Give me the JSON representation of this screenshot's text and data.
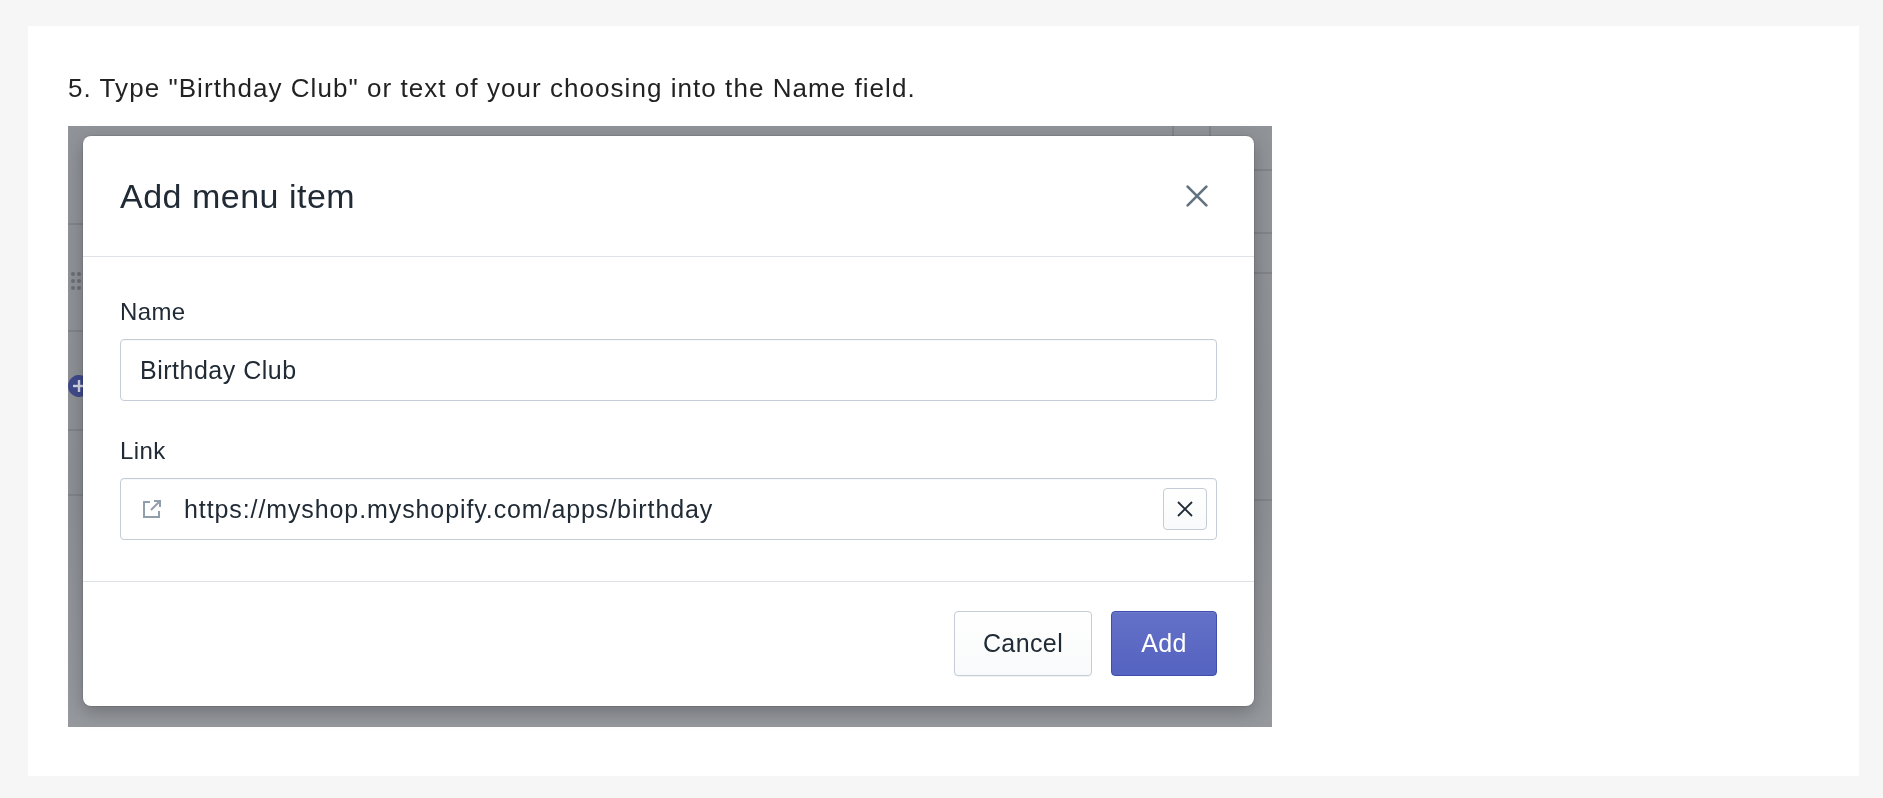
{
  "instruction": "5. Type \"Birthday Club\" or text of your choosing into the Name field.",
  "screenshot": {
    "dialog": {
      "title": "Add menu item",
      "fields": [
        {
          "kind": "text",
          "label": "Name",
          "value": "Birthday Club"
        },
        {
          "kind": "link",
          "label": "Link",
          "value": "https://myshop.myshopify.com/apps/birthday"
        }
      ],
      "buttons": [
        {
          "kind": "secondary",
          "label": "Cancel"
        },
        {
          "kind": "primary",
          "label": "Add"
        }
      ]
    }
  }
}
